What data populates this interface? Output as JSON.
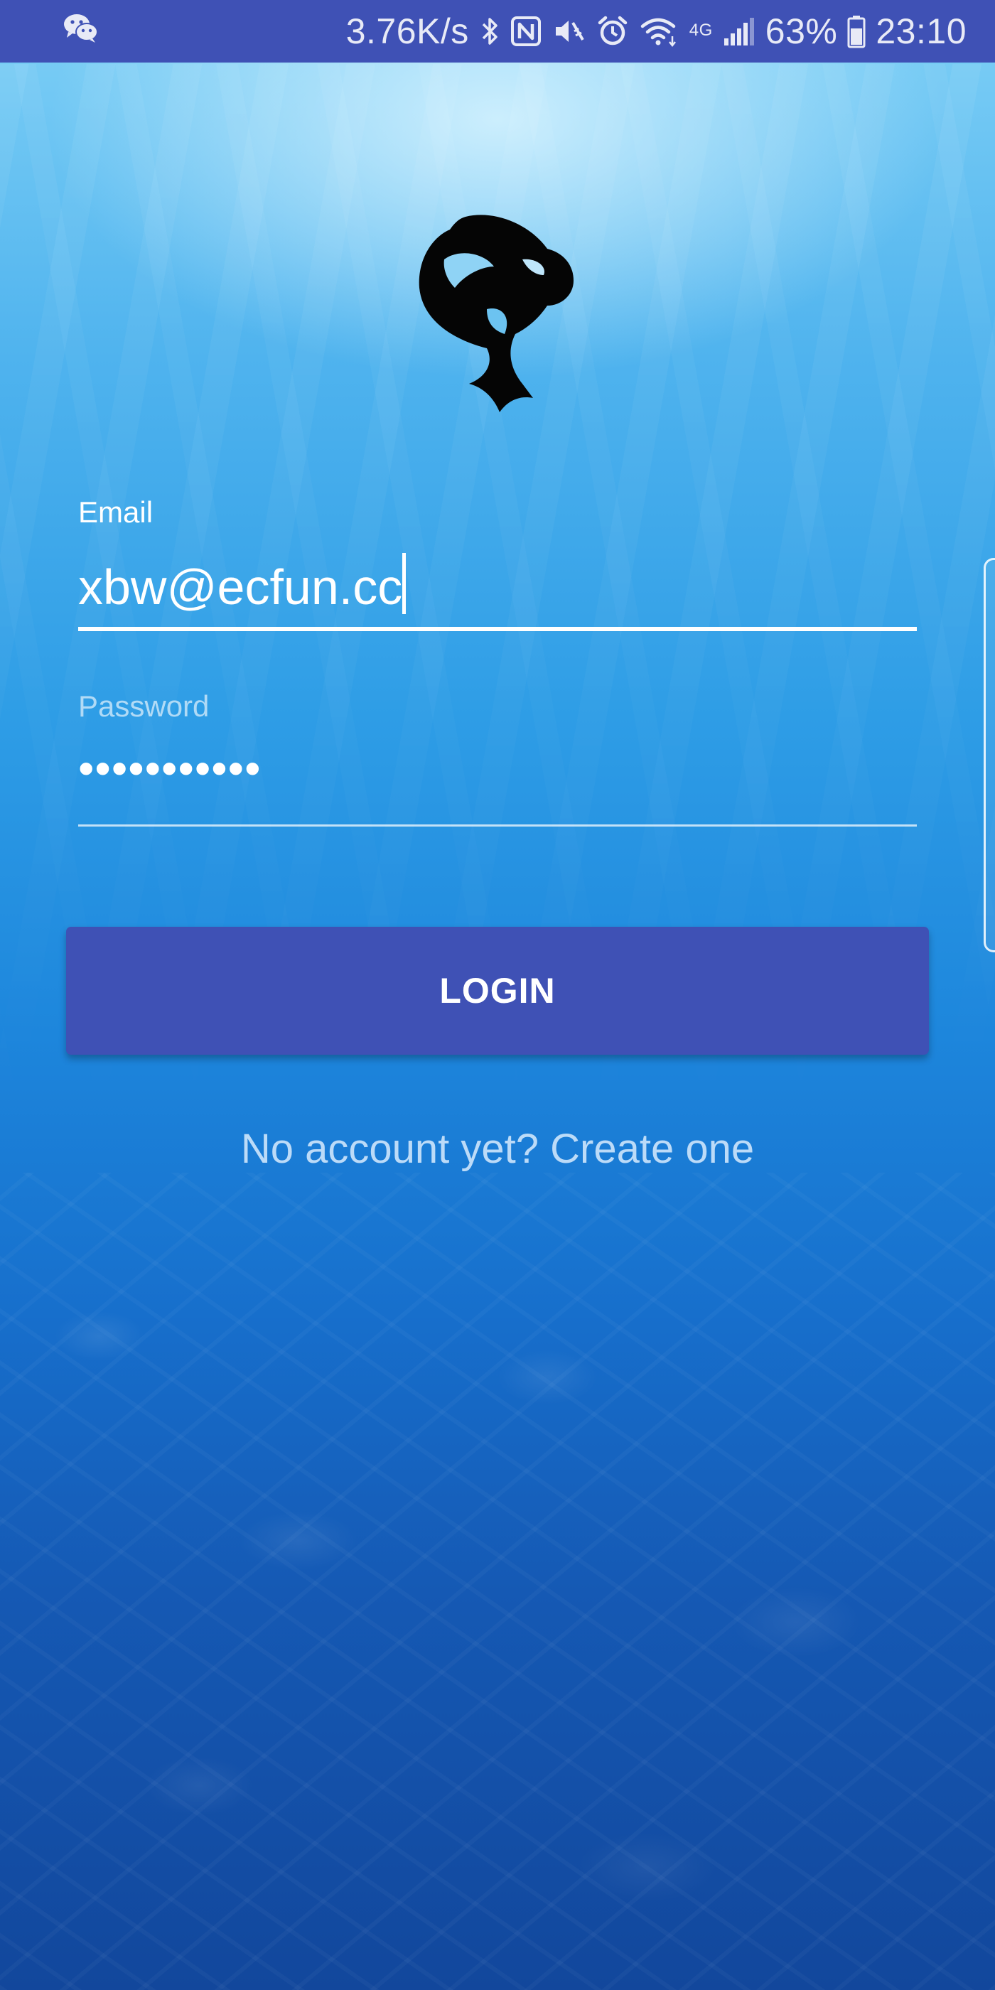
{
  "status_bar": {
    "network_speed": "3.76K/s",
    "network_type": "4G",
    "battery": "63%",
    "time": "23:10",
    "icons": [
      "wechat-icon",
      "bluetooth-icon",
      "nfc-icon",
      "vibrate-mute-icon",
      "alarm-icon",
      "wifi-icon",
      "signal-icon",
      "battery-icon"
    ],
    "color": "#3f51b5"
  },
  "logo": {
    "icon": "orca-logo"
  },
  "form": {
    "email": {
      "label": "Email",
      "value": "xbw@ecfun.cc"
    },
    "password": {
      "label": "Password",
      "value_masked": "•••••••••••"
    },
    "login_label": "LOGIN",
    "signup_text": "No account yet? Create one"
  },
  "colors": {
    "accent": "#3f51b5",
    "text_primary": "#ffffff"
  }
}
